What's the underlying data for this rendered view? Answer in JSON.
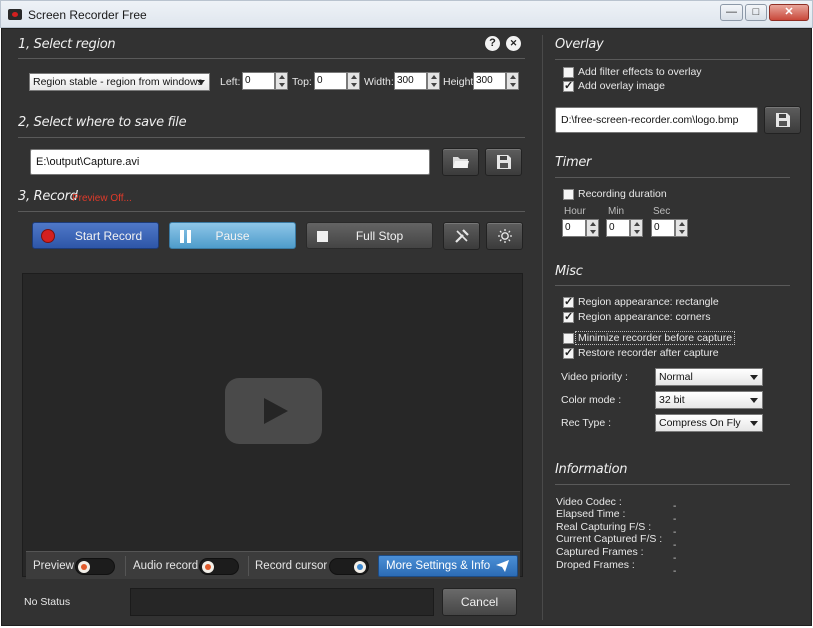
{
  "window": {
    "title": "Screen Recorder Free",
    "controls": {
      "minimize": "—",
      "maximize": "□",
      "close": "✕"
    }
  },
  "region": {
    "section_title": "1, Select region",
    "help_icon": "?",
    "close_icon": "✕",
    "mode": "Region stable - region from windows",
    "left_label": "Left:",
    "left_value": "0",
    "top_label": "Top:",
    "top_value": "0",
    "width_label": "Width:",
    "width_value": "300",
    "height_label": "Height:",
    "height_value": "300"
  },
  "save": {
    "section_title": "2, Select where to save file",
    "path": "E:\\output\\Capture.avi",
    "icons": [
      "folder-open-icon",
      "save-disk-icon"
    ]
  },
  "record": {
    "section_title": "3, Record",
    "preview_status": "Preview Off...",
    "start_label": "Start Record",
    "pause_label": "Pause",
    "stop_label": "Full Stop",
    "icons": [
      "record-dot-icon",
      "pause-icon",
      "stop-square-icon",
      "tools-icon",
      "brightness-icon",
      "play-logo-icon"
    ]
  },
  "toggles": {
    "preview_label": "Preview",
    "preview_on": false,
    "audio_label": "Audio record",
    "audio_on": false,
    "cursor_label": "Record cursor",
    "cursor_on": true,
    "more_settings_label": "More Settings & Info",
    "more_settings_icon": "paper-plane-icon"
  },
  "status": {
    "text": "No Status",
    "cancel_label": "Cancel"
  },
  "overlay": {
    "section_title": "Overlay",
    "filter_label": "Add filter effects to overlay",
    "filter_checked": false,
    "image_label": "Add overlay image",
    "image_checked": true,
    "image_path": "D:\\free-screen-recorder.com\\logo.bmp"
  },
  "timer": {
    "section_title": "Timer",
    "duration_label": "Recording duration",
    "duration_checked": false,
    "hour_label": "Hour",
    "hour_value": "0",
    "min_label": "Min",
    "min_value": "0",
    "sec_label": "Sec",
    "sec_value": "0"
  },
  "misc": {
    "section_title": "Misc",
    "checks": [
      {
        "label": "Region appearance: rectangle",
        "checked": true
      },
      {
        "label": "Region appearance: corners",
        "checked": true
      },
      {
        "label": "Minimize recorder before capture",
        "checked": false
      },
      {
        "label": "Restore recorder after capture",
        "checked": true
      }
    ],
    "video_priority_label": "Video priority :",
    "video_priority_value": "Normal",
    "color_mode_label": "Color mode :",
    "color_mode_value": "32 bit",
    "rec_type_label": "Rec Type :",
    "rec_type_value": "Compress On Fly"
  },
  "information": {
    "section_title": "Information",
    "rows": [
      {
        "label": "Video Codec :",
        "value": "-"
      },
      {
        "label": "Elapsed Time :",
        "value": "-"
      },
      {
        "label": "Real Capturing F/S :",
        "value": "-"
      },
      {
        "label": "Current Captured F/S :",
        "value": "-"
      },
      {
        "label": "Captured Frames :",
        "value": "-"
      },
      {
        "label": "Droped Frames :",
        "value": "-"
      }
    ]
  },
  "colors": {
    "panel_bg": "#323232",
    "start_blue": "#2e56a8",
    "pause_blue": "#4e9ccb",
    "accent_red": "#d32020",
    "preview_status_red": "#e03a2a"
  }
}
